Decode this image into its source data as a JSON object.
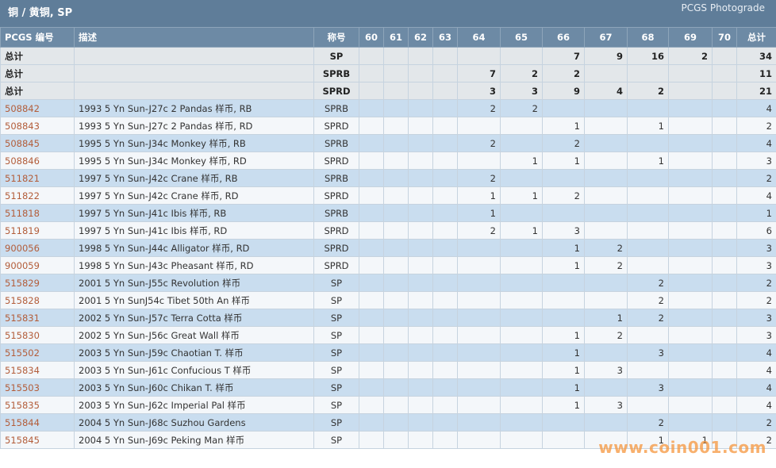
{
  "header": {
    "title": "铜 / 黄铜, SP",
    "photograde_link": "PCGS Photograde"
  },
  "table": {
    "columns": [
      "PCGS 编号",
      "描述",
      "称号",
      "60",
      "61",
      "62",
      "63",
      "64",
      "65",
      "66",
      "67",
      "68",
      "69",
      "70",
      "总计"
    ],
    "totals": [
      {
        "label": "总计",
        "code": "SP",
        "grades": [
          "",
          "",
          "",
          "",
          "",
          "",
          "7",
          "9",
          "16",
          "2",
          ""
        ],
        "total": "34"
      },
      {
        "label": "总计",
        "code": "SPRB",
        "grades": [
          "",
          "",
          "",
          "",
          "7",
          "2",
          "2",
          "",
          "",
          "",
          ""
        ],
        "total": "11"
      },
      {
        "label": "总计",
        "code": "SPRD",
        "grades": [
          "",
          "",
          "",
          "",
          "3",
          "3",
          "9",
          "4",
          "2",
          "",
          ""
        ],
        "total": "21"
      }
    ],
    "rows": [
      {
        "pcgs": "508842",
        "desc": "1993 5 Yn Sun-J27c 2 Pandas 样币, RB",
        "code": "SPRB",
        "grades": [
          "",
          "",
          "",
          "",
          "2",
          "2",
          "",
          "",
          "",
          "",
          ""
        ],
        "total": "4"
      },
      {
        "pcgs": "508843",
        "desc": "1993 5 Yn Sun-J27c 2 Pandas 样币, RD",
        "code": "SPRD",
        "grades": [
          "",
          "",
          "",
          "",
          "",
          "",
          "1",
          "",
          "1",
          "",
          ""
        ],
        "total": "2"
      },
      {
        "pcgs": "508845",
        "desc": "1995 5 Yn Sun-J34c Monkey 样币, RB",
        "code": "SPRB",
        "grades": [
          "",
          "",
          "",
          "",
          "2",
          "",
          "2",
          "",
          "",
          "",
          ""
        ],
        "total": "4"
      },
      {
        "pcgs": "508846",
        "desc": "1995 5 Yn Sun-J34c Monkey 样币, RD",
        "code": "SPRD",
        "grades": [
          "",
          "",
          "",
          "",
          "",
          "1",
          "1",
          "",
          "1",
          "",
          ""
        ],
        "total": "3"
      },
      {
        "pcgs": "511821",
        "desc": "1997 5 Yn Sun-J42c Crane 样币, RB",
        "code": "SPRB",
        "grades": [
          "",
          "",
          "",
          "",
          "2",
          "",
          "",
          "",
          "",
          "",
          ""
        ],
        "total": "2"
      },
      {
        "pcgs": "511822",
        "desc": "1997 5 Yn Sun-J42c Crane 样币, RD",
        "code": "SPRD",
        "grades": [
          "",
          "",
          "",
          "",
          "1",
          "1",
          "2",
          "",
          "",
          "",
          ""
        ],
        "total": "4"
      },
      {
        "pcgs": "511818",
        "desc": "1997 5 Yn Sun-J41c Ibis 样币, RB",
        "code": "SPRB",
        "grades": [
          "",
          "",
          "",
          "",
          "1",
          "",
          "",
          "",
          "",
          "",
          ""
        ],
        "total": "1"
      },
      {
        "pcgs": "511819",
        "desc": "1997 5 Yn Sun-J41c Ibis 样币, RD",
        "code": "SPRD",
        "grades": [
          "",
          "",
          "",
          "",
          "2",
          "1",
          "3",
          "",
          "",
          "",
          ""
        ],
        "total": "6"
      },
      {
        "pcgs": "900056",
        "desc": "1998 5 Yn Sun-J44c Alligator 样币, RD",
        "code": "SPRD",
        "grades": [
          "",
          "",
          "",
          "",
          "",
          "",
          "1",
          "2",
          "",
          "",
          ""
        ],
        "total": "3"
      },
      {
        "pcgs": "900059",
        "desc": "1998 5 Yn Sun-J43c Pheasant 样币, RD",
        "code": "SPRD",
        "grades": [
          "",
          "",
          "",
          "",
          "",
          "",
          "1",
          "2",
          "",
          "",
          ""
        ],
        "total": "3"
      },
      {
        "pcgs": "515829",
        "desc": "2001 5 Yn Sun-J55c Revolution 样币",
        "code": "SP",
        "grades": [
          "",
          "",
          "",
          "",
          "",
          "",
          "",
          "",
          "2",
          "",
          ""
        ],
        "total": "2"
      },
      {
        "pcgs": "515828",
        "desc": "2001 5 Yn SunJ54c Tibet 50th An 样币",
        "code": "SP",
        "grades": [
          "",
          "",
          "",
          "",
          "",
          "",
          "",
          "",
          "2",
          "",
          ""
        ],
        "total": "2"
      },
      {
        "pcgs": "515831",
        "desc": "2002 5 Yn Sun-J57c Terra Cotta 样币",
        "code": "SP",
        "grades": [
          "",
          "",
          "",
          "",
          "",
          "",
          "",
          "1",
          "2",
          "",
          ""
        ],
        "total": "3"
      },
      {
        "pcgs": "515830",
        "desc": "2002 5 Yn Sun-J56c Great Wall 样币",
        "code": "SP",
        "grades": [
          "",
          "",
          "",
          "",
          "",
          "",
          "1",
          "2",
          "",
          "",
          ""
        ],
        "total": "3"
      },
      {
        "pcgs": "515502",
        "desc": "2003 5 Yn Sun-J59c Chaotian T. 样币",
        "code": "SP",
        "grades": [
          "",
          "",
          "",
          "",
          "",
          "",
          "1",
          "",
          "3",
          "",
          ""
        ],
        "total": "4"
      },
      {
        "pcgs": "515834",
        "desc": "2003 5 Yn Sun-J61c Confucious T 样币",
        "code": "SP",
        "grades": [
          "",
          "",
          "",
          "",
          "",
          "",
          "1",
          "3",
          "",
          "",
          ""
        ],
        "total": "4"
      },
      {
        "pcgs": "515503",
        "desc": "2003 5 Yn Sun-J60c Chikan T. 样币",
        "code": "SP",
        "grades": [
          "",
          "",
          "",
          "",
          "",
          "",
          "1",
          "",
          "3",
          "",
          ""
        ],
        "total": "4"
      },
      {
        "pcgs": "515835",
        "desc": "2003 5 Yn Sun-J62c Imperial Pal 样币",
        "code": "SP",
        "grades": [
          "",
          "",
          "",
          "",
          "",
          "",
          "1",
          "3",
          "",
          "",
          ""
        ],
        "total": "4"
      },
      {
        "pcgs": "515844",
        "desc": "2004 5 Yn Sun-J68c Suzhou Gardens",
        "code": "SP",
        "grades": [
          "",
          "",
          "",
          "",
          "",
          "",
          "",
          "",
          "2",
          "",
          ""
        ],
        "total": "2"
      },
      {
        "pcgs": "515845",
        "desc": "2004 5 Yn Sun-J69c Peking Man 样币",
        "code": "SP",
        "grades": [
          "",
          "",
          "",
          "",
          "",
          "",
          "",
          "",
          "1",
          "1",
          ""
        ],
        "total": "2"
      }
    ]
  },
  "watermark": "www.coin001.com"
}
